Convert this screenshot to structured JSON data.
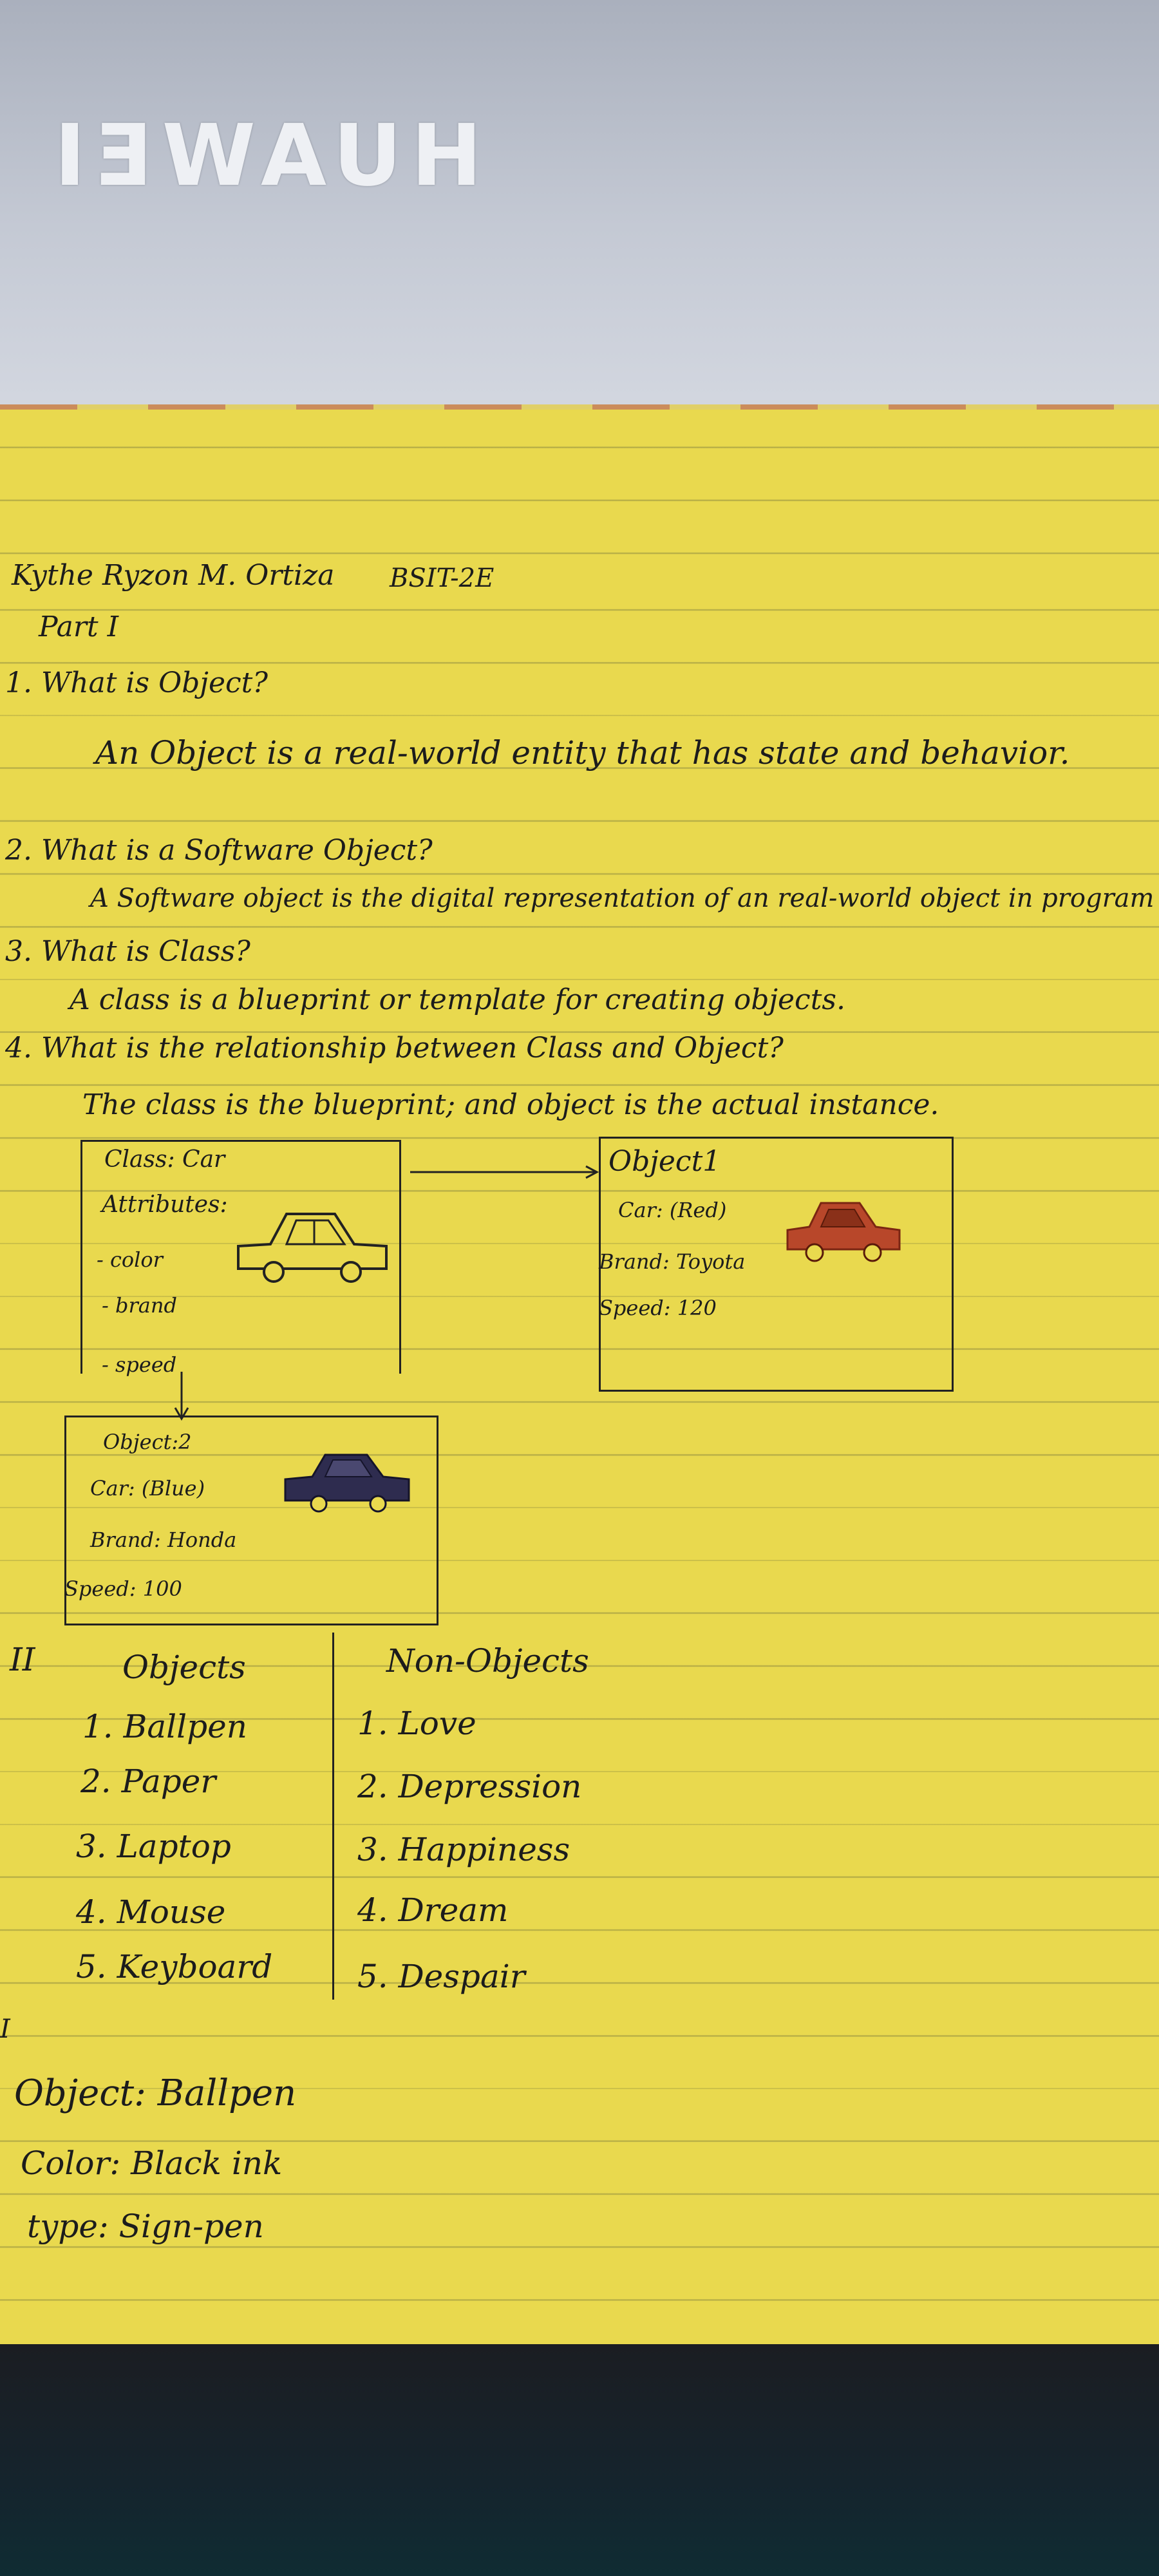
{
  "background": {
    "logo_text": "HUAWEI"
  },
  "header": {
    "name": "Kythe Ryzon M. Ortiza",
    "section": "BSIT-2E",
    "part": "Part I"
  },
  "questions": [
    {
      "q": "1. What is Object?",
      "a": "An Object is a real-world entity that has state and behavior."
    },
    {
      "q": "2. What is a Software Object?",
      "a": "A Software object is the digital representation of an real-world object in program"
    },
    {
      "q": "3. What is Class?",
      "a": "A class is a blueprint or template for creating objects."
    },
    {
      "q": "4. What is the relationship between Class and Object?",
      "a": "The class is the blueprint; and object is the actual instance."
    }
  ],
  "class_box": {
    "title": "Class: Car",
    "attributes_label": "Attributes:",
    "attributes": [
      "- color",
      "- brand",
      "- speed"
    ]
  },
  "object1": {
    "title": "Object1",
    "car": "Car: (Red)",
    "brand": "Brand: Toyota",
    "speed": "Speed: 120",
    "car_color": "#b8472a"
  },
  "object2": {
    "title": "Object:2",
    "car": "Car: (Blue)",
    "brand": "Brand: Honda",
    "speed": "Speed: 100",
    "car_color": "#2e2c4f"
  },
  "part2": {
    "roman": "II",
    "objects_header": "Objects",
    "objects": [
      "1. Ballpen",
      "2. Paper",
      "3. Laptop",
      "4. Mouse",
      "5. Keyboard"
    ],
    "non_objects_header": "Non-Objects",
    "non_objects": [
      "1. Love",
      "2. Depression",
      "3. Happiness",
      "4. Dream",
      "5. Despair"
    ]
  },
  "part3": {
    "roman": "I",
    "object": "Object: Ballpen",
    "color": "Color: Black ink",
    "type": "type: Sign-pen"
  }
}
